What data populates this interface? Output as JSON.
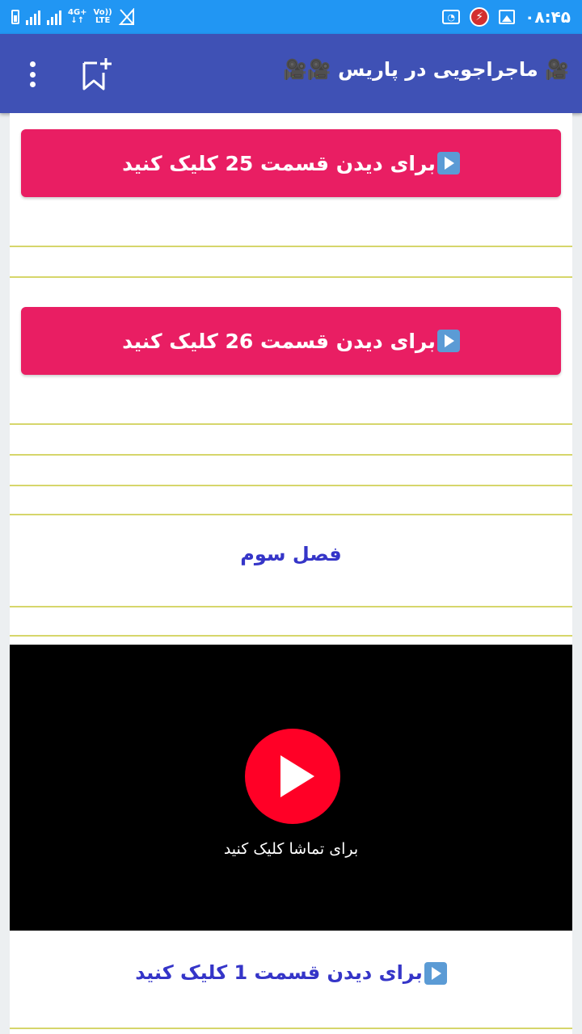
{
  "status_bar": {
    "time": "۰۸:۴۵",
    "network_top": "4G+",
    "network_bottom": "↓↑",
    "volte_top": "Vo))",
    "volte_bottom": "LTE"
  },
  "app_bar": {
    "title": "🎥 ماجراجویی در پاریس 🎥🎥",
    "title_emoji": "🎥"
  },
  "content": {
    "episode_buttons": [
      {
        "label": "برای دیدن قسمت 25  کلیک کنید"
      },
      {
        "label": "برای دیدن قسمت 26  کلیک کنید"
      }
    ],
    "section_title": "فصل سوم",
    "video": {
      "caption": "برای تماشا کلیک کنید"
    },
    "episode_link": "برای دیدن قسمت 1 کلیک کنید"
  },
  "colors": {
    "status_bar": "#2196f3",
    "app_bar": "#3f51b5",
    "button": "#e91e63",
    "link": "#3535c8",
    "divider": "#d6d66b",
    "play": "#ff0026"
  }
}
